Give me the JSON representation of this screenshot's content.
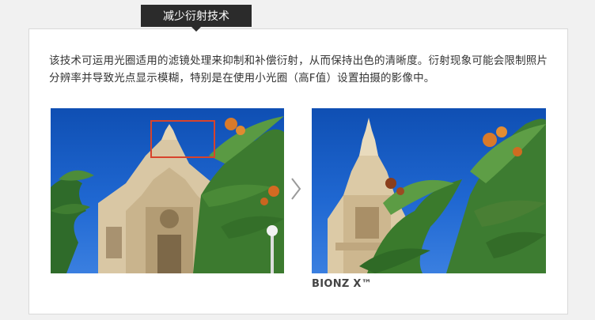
{
  "header": {
    "tab_title": "减少衍射技术"
  },
  "content": {
    "description": "该技术可运用光圈适用的滤镜处理来抑制和补偿衍射，从而保持出色的清晰度。衍射现象可能会限制照片分辨率并导致光点显示模糊，特别是在使用小光圈（高F值）设置拍摄的影像中。",
    "after_caption": "BIONZ X™"
  },
  "colors": {
    "tab_background": "#2b2b2b",
    "highlight_border": "#d8432b",
    "sky": "#1f67d1"
  },
  "icons": {
    "next_arrow": "chevron-right-icon"
  }
}
